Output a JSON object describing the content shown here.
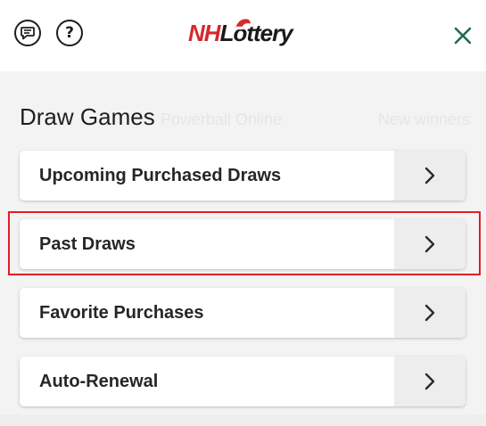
{
  "header": {
    "chat_icon": "chat-bubble-icon",
    "help_icon": "question-mark-icon",
    "help_glyph": "?",
    "logo": {
      "part1": "NH",
      "part2": "Lottery",
      "colors": {
        "nh": "#d6282e",
        "lottery": "#1a1a1a",
        "hat": "#d6282e"
      }
    },
    "close_icon": "close-icon",
    "close_color": "#1e6b57"
  },
  "background_text": {
    "left": "Powerball Online",
    "right": "New winners"
  },
  "section": {
    "title": "Draw Games",
    "items": [
      {
        "label": "Upcoming Purchased Draws",
        "icon": "chevron-right-icon"
      },
      {
        "label": "Past Draws",
        "icon": "chevron-right-icon",
        "highlighted": true
      },
      {
        "label": "Favorite Purchases",
        "icon": "chevron-right-icon"
      },
      {
        "label": "Auto-Renewal",
        "icon": "chevron-right-icon"
      }
    ]
  },
  "highlight_color": "#e31e24"
}
